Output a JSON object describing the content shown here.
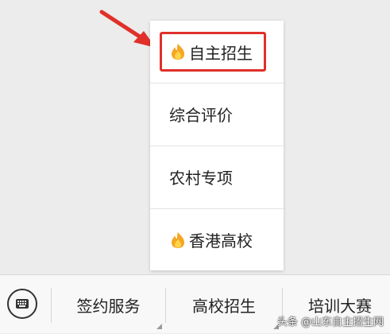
{
  "menu": {
    "items": [
      {
        "label": "自主招生",
        "icon": "fire-icon",
        "highlighted": true
      },
      {
        "label": "综合评价",
        "icon": null,
        "highlighted": false
      },
      {
        "label": "农村专项",
        "icon": null,
        "highlighted": false
      },
      {
        "label": "香港高校",
        "icon": "fire-icon",
        "highlighted": false
      }
    ]
  },
  "bottom_bar": {
    "keyboard_icon": "keyboard-icon",
    "tabs": [
      "签约服务",
      "高校招生",
      "培训大赛"
    ]
  },
  "watermark": "头条 @山东自主招生网",
  "colors": {
    "highlight": "#e0302a",
    "arrow": "#e0302a"
  }
}
